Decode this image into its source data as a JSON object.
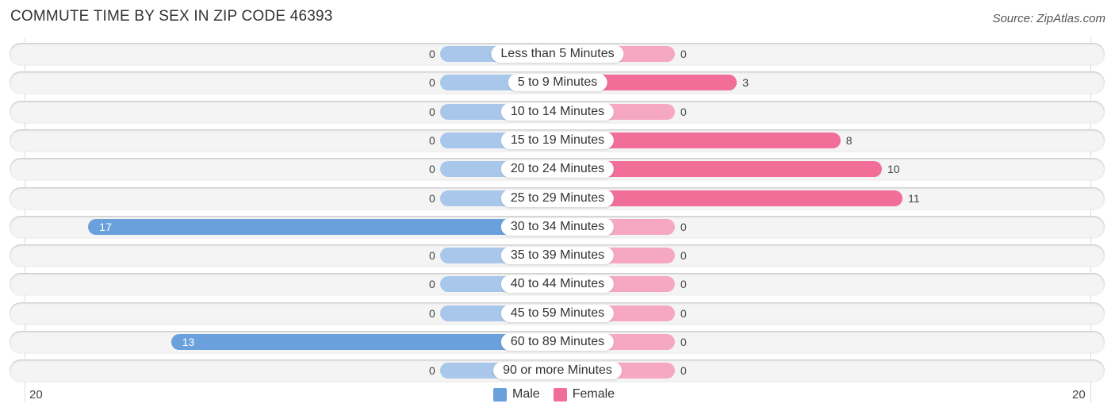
{
  "header": {
    "title": "COMMUTE TIME BY SEX IN ZIP CODE 46393",
    "source": "Source: ZipAtlas.com"
  },
  "colors": {
    "male": "#6aa0dc",
    "male_light": "#a9c7ea",
    "female": "#f06e98",
    "female_light": "#f6a8c2"
  },
  "chart_data": {
    "type": "bar",
    "orientation": "horizontal-diverging",
    "title": "COMMUTE TIME BY SEX IN ZIP CODE 46393",
    "categories": [
      "Less than 5 Minutes",
      "5 to 9 Minutes",
      "10 to 14 Minutes",
      "15 to 19 Minutes",
      "20 to 24 Minutes",
      "25 to 29 Minutes",
      "30 to 34 Minutes",
      "35 to 39 Minutes",
      "40 to 44 Minutes",
      "45 to 59 Minutes",
      "60 to 89 Minutes",
      "90 or more Minutes"
    ],
    "series": [
      {
        "name": "Male",
        "values": [
          0,
          0,
          0,
          0,
          0,
          0,
          17,
          0,
          0,
          0,
          13,
          0
        ]
      },
      {
        "name": "Female",
        "values": [
          0,
          3,
          0,
          8,
          10,
          11,
          0,
          0,
          0,
          0,
          0,
          0
        ]
      }
    ],
    "axis": {
      "left_label": "20",
      "right_label": "20",
      "range": [
        -20,
        20
      ]
    },
    "legend": {
      "items": [
        "Male",
        "Female"
      ],
      "placement": "bottom-center"
    }
  }
}
